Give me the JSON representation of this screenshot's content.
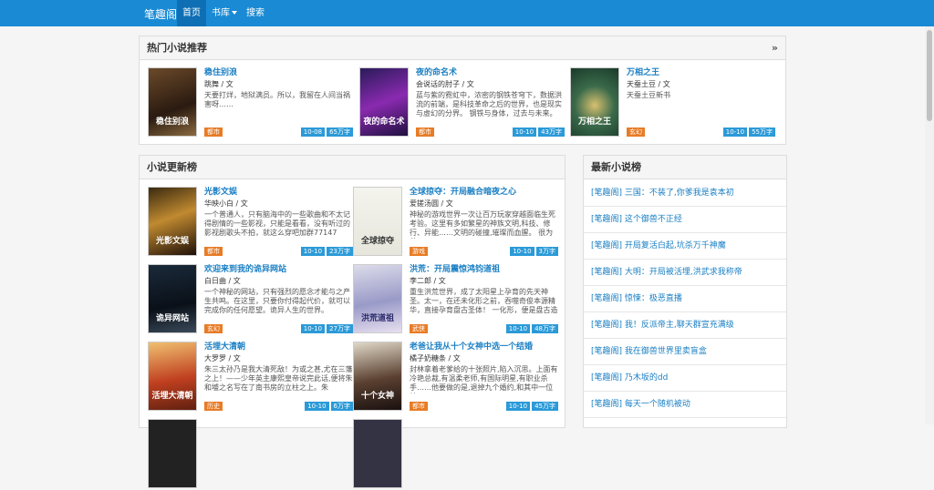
{
  "nav": {
    "brand": "笔趣阁",
    "home": "首页",
    "library": "书库",
    "search": "搜索"
  },
  "hot": {
    "title": "热门小说推荐",
    "more": "»",
    "books": [
      {
        "title": "稳住别浪",
        "author": "跳舞 / 文",
        "desc": "天要打烊，地狱满员。所以，我留在人间当祸害呀……",
        "tag": "都市",
        "date": "10-08",
        "words": "65万字",
        "cover_text": "稳住别浪"
      },
      {
        "title": "夜的命名术",
        "author": "会说话的肘子 / 文",
        "desc": "蓝与紫的霓虹中，浓密的钢铁苍穹下，数据洪流的前端，是科技革命之后的世界，也是现实与虚幻的分界。 钢铁与身体，过去与未来。",
        "tag": "都市",
        "date": "10-10",
        "words": "43万字",
        "cover_text": "夜的命名术"
      },
      {
        "title": "万相之王",
        "author": "天蚕土豆 / 文",
        "desc": "天蚕土豆新书",
        "tag": "玄幻",
        "date": "10-10",
        "words": "55万字",
        "cover_text": "万相之王"
      }
    ]
  },
  "updates": {
    "title": "小说更新榜",
    "books": [
      {
        "title": "光影文娱",
        "author": "华映小白 / 文",
        "desc": "一个普通人，只有脑海中的一些歌曲和不太记得剧情的一些影视，只能是看看，没有听过的影视剧歌头不拍，就这么穿吧加群77147",
        "tag": "都市",
        "date": "10-10",
        "words": "23万字",
        "cover_text": "光影文娱"
      },
      {
        "title": "全球掠夺：开局融合暗夜之心",
        "author": "爱搓汤圆 / 文",
        "desc": "神秘的游戏世界一次让百万玩家穿越面临生死考验。这里有多如繁星的神族文明,科技、修行、异能……文明的碰撞,璀璨而血腥。 很为曾",
        "tag": "游戏",
        "date": "10-10",
        "words": "3万字",
        "cover_text": "全球掠夺"
      },
      {
        "title": "欢迎来到我的诡异网站",
        "author": "白日曲 / 文",
        "desc": "一个神秘的网站，只有强烈的愿念才能与之产生共鸣。在这里，只要你付得起代价，就可以完成你的任何愿望。诡异人生的世界。",
        "tag": "玄幻",
        "date": "10-10",
        "words": "27万字",
        "cover_text": "诡异网站"
      },
      {
        "title": "洪荒：开局震惊鸿钧道祖",
        "author": "李二郎 / 文",
        "desc": "重生洪荒世界，成了太阳星上孕育的先天神圣。太一，在还未化形之前，吞噬奇俊本源精华，直接孕育盘古圣体！ 一化形，便是盘古造",
        "tag": "武侠",
        "date": "10-10",
        "words": "48万字",
        "cover_text": "洪荒道祖"
      },
      {
        "title": "活埋大清朝",
        "author": "大罗罗 / 文",
        "desc": "朱三太孙乃是我大清死敌！为或之甚,尤在三藩之上！——少年英主康熙皇帝说完此话,便将朱和墭之名写在了南书房的立柱之上。朱",
        "tag": "历史",
        "date": "10-10",
        "words": "6万字",
        "cover_text": "活埋大清朝"
      },
      {
        "title": "老爸让我从十个女神中选一个结婚",
        "author": "橘子奶糖条 / 文",
        "desc": "封林拿着老爹给的十张照片,陷入沉思。上面有冷艳总裁,有温柔老师,有国际明星,有职业杀手……他要做的是,退掉九个婚约,和其中一位结",
        "tag": "都市",
        "date": "10-10",
        "words": "45万字",
        "cover_text": "十个女神"
      }
    ]
  },
  "latest": {
    "title": "最新小说榜",
    "items": [
      "[笔趣阁] 三国：不装了,你爹我是袁本初",
      "[笔趣阁] 这个御兽不正经",
      "[笔趣阁] 开局复活白起,坑杀万千神魔",
      "[笔趣阁] 大明：开局被活埋,洪武求我称帝",
      "[笔趣阁] 惊悚：极恶直播",
      "[笔趣阁] 我！反派帝主,聊天群宣充满级",
      "[笔趣阁] 我在御兽世界里卖盲盒",
      "[笔趣阁] 乃木坂的dd",
      "[笔趣阁] 每天一个随机被动"
    ]
  },
  "colors": {
    "nav_bg": "#1a8ad4",
    "link": "#1a7fc3",
    "tag": "#e87c26",
    "pill": "#2b9ad8"
  }
}
